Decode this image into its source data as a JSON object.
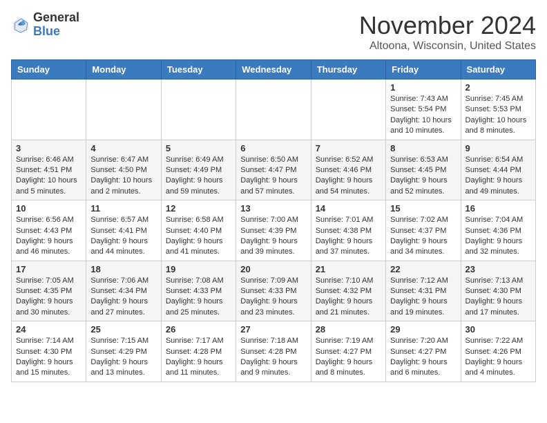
{
  "header": {
    "logo_general": "General",
    "logo_blue": "Blue",
    "month_title": "November 2024",
    "location": "Altoona, Wisconsin, United States"
  },
  "days_of_week": [
    "Sunday",
    "Monday",
    "Tuesday",
    "Wednesday",
    "Thursday",
    "Friday",
    "Saturday"
  ],
  "weeks": [
    [
      {
        "day": "",
        "info": ""
      },
      {
        "day": "",
        "info": ""
      },
      {
        "day": "",
        "info": ""
      },
      {
        "day": "",
        "info": ""
      },
      {
        "day": "",
        "info": ""
      },
      {
        "day": "1",
        "info": "Sunrise: 7:43 AM\nSunset: 5:54 PM\nDaylight: 10 hours and 10 minutes."
      },
      {
        "day": "2",
        "info": "Sunrise: 7:45 AM\nSunset: 5:53 PM\nDaylight: 10 hours and 8 minutes."
      }
    ],
    [
      {
        "day": "3",
        "info": "Sunrise: 6:46 AM\nSunset: 4:51 PM\nDaylight: 10 hours and 5 minutes."
      },
      {
        "day": "4",
        "info": "Sunrise: 6:47 AM\nSunset: 4:50 PM\nDaylight: 10 hours and 2 minutes."
      },
      {
        "day": "5",
        "info": "Sunrise: 6:49 AM\nSunset: 4:49 PM\nDaylight: 9 hours and 59 minutes."
      },
      {
        "day": "6",
        "info": "Sunrise: 6:50 AM\nSunset: 4:47 PM\nDaylight: 9 hours and 57 minutes."
      },
      {
        "day": "7",
        "info": "Sunrise: 6:52 AM\nSunset: 4:46 PM\nDaylight: 9 hours and 54 minutes."
      },
      {
        "day": "8",
        "info": "Sunrise: 6:53 AM\nSunset: 4:45 PM\nDaylight: 9 hours and 52 minutes."
      },
      {
        "day": "9",
        "info": "Sunrise: 6:54 AM\nSunset: 4:44 PM\nDaylight: 9 hours and 49 minutes."
      }
    ],
    [
      {
        "day": "10",
        "info": "Sunrise: 6:56 AM\nSunset: 4:43 PM\nDaylight: 9 hours and 46 minutes."
      },
      {
        "day": "11",
        "info": "Sunrise: 6:57 AM\nSunset: 4:41 PM\nDaylight: 9 hours and 44 minutes."
      },
      {
        "day": "12",
        "info": "Sunrise: 6:58 AM\nSunset: 4:40 PM\nDaylight: 9 hours and 41 minutes."
      },
      {
        "day": "13",
        "info": "Sunrise: 7:00 AM\nSunset: 4:39 PM\nDaylight: 9 hours and 39 minutes."
      },
      {
        "day": "14",
        "info": "Sunrise: 7:01 AM\nSunset: 4:38 PM\nDaylight: 9 hours and 37 minutes."
      },
      {
        "day": "15",
        "info": "Sunrise: 7:02 AM\nSunset: 4:37 PM\nDaylight: 9 hours and 34 minutes."
      },
      {
        "day": "16",
        "info": "Sunrise: 7:04 AM\nSunset: 4:36 PM\nDaylight: 9 hours and 32 minutes."
      }
    ],
    [
      {
        "day": "17",
        "info": "Sunrise: 7:05 AM\nSunset: 4:35 PM\nDaylight: 9 hours and 30 minutes."
      },
      {
        "day": "18",
        "info": "Sunrise: 7:06 AM\nSunset: 4:34 PM\nDaylight: 9 hours and 27 minutes."
      },
      {
        "day": "19",
        "info": "Sunrise: 7:08 AM\nSunset: 4:33 PM\nDaylight: 9 hours and 25 minutes."
      },
      {
        "day": "20",
        "info": "Sunrise: 7:09 AM\nSunset: 4:33 PM\nDaylight: 9 hours and 23 minutes."
      },
      {
        "day": "21",
        "info": "Sunrise: 7:10 AM\nSunset: 4:32 PM\nDaylight: 9 hours and 21 minutes."
      },
      {
        "day": "22",
        "info": "Sunrise: 7:12 AM\nSunset: 4:31 PM\nDaylight: 9 hours and 19 minutes."
      },
      {
        "day": "23",
        "info": "Sunrise: 7:13 AM\nSunset: 4:30 PM\nDaylight: 9 hours and 17 minutes."
      }
    ],
    [
      {
        "day": "24",
        "info": "Sunrise: 7:14 AM\nSunset: 4:30 PM\nDaylight: 9 hours and 15 minutes."
      },
      {
        "day": "25",
        "info": "Sunrise: 7:15 AM\nSunset: 4:29 PM\nDaylight: 9 hours and 13 minutes."
      },
      {
        "day": "26",
        "info": "Sunrise: 7:17 AM\nSunset: 4:28 PM\nDaylight: 9 hours and 11 minutes."
      },
      {
        "day": "27",
        "info": "Sunrise: 7:18 AM\nSunset: 4:28 PM\nDaylight: 9 hours and 9 minutes."
      },
      {
        "day": "28",
        "info": "Sunrise: 7:19 AM\nSunset: 4:27 PM\nDaylight: 9 hours and 8 minutes."
      },
      {
        "day": "29",
        "info": "Sunrise: 7:20 AM\nSunset: 4:27 PM\nDaylight: 9 hours and 6 minutes."
      },
      {
        "day": "30",
        "info": "Sunrise: 7:22 AM\nSunset: 4:26 PM\nDaylight: 9 hours and 4 minutes."
      }
    ]
  ]
}
